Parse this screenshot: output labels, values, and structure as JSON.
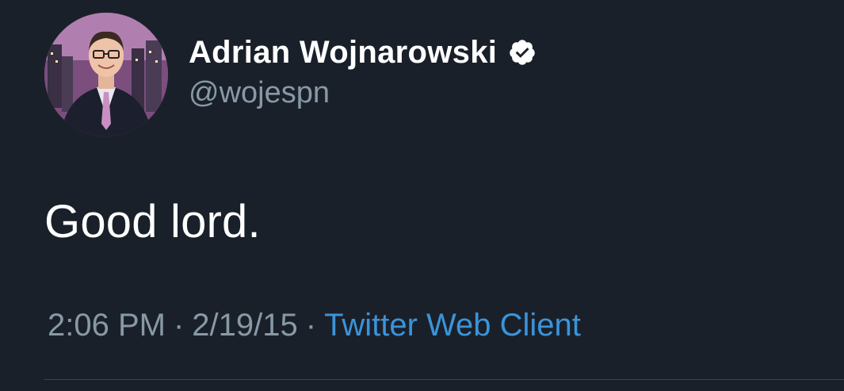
{
  "tweet": {
    "author": {
      "display_name": "Adrian Wojnarowski",
      "handle": "@wojespn",
      "verified": true,
      "verified_icon": "verified-badge-icon"
    },
    "text": "Good lord.",
    "time": "2:06 PM",
    "date": "2/19/15",
    "separator": "·",
    "source": "Twitter Web Client"
  },
  "colors": {
    "background": "#1a202a",
    "primary_text": "#ffffff",
    "secondary_text": "#8899a6",
    "link": "#3b94d9",
    "divider": "#38444d"
  }
}
